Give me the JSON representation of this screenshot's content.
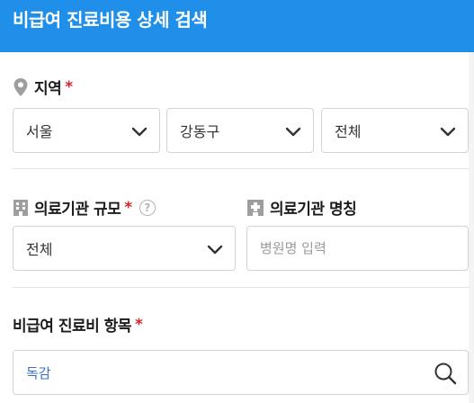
{
  "header": {
    "title": "비급여 진료비용 상세 검색"
  },
  "region": {
    "label": "지역",
    "required_mark": "*",
    "icon": "map-pin-icon",
    "selects": [
      {
        "value": "서울"
      },
      {
        "value": "강동구"
      },
      {
        "value": "전체"
      }
    ]
  },
  "institution_size": {
    "label": "의료기관 규모",
    "required_mark": "*",
    "icon": "building-icon",
    "help": "?",
    "value": "전체"
  },
  "institution_name": {
    "label": "의료기관 명칭",
    "icon": "hospital-icon",
    "placeholder": "병원명 입력"
  },
  "noncovered_item": {
    "label": "비급여 진료비 항목",
    "required_mark": "*",
    "value": "독감",
    "value_color": "#3a6fc4"
  },
  "colors": {
    "header": "#1f8fe9",
    "required": "#d8242a"
  }
}
